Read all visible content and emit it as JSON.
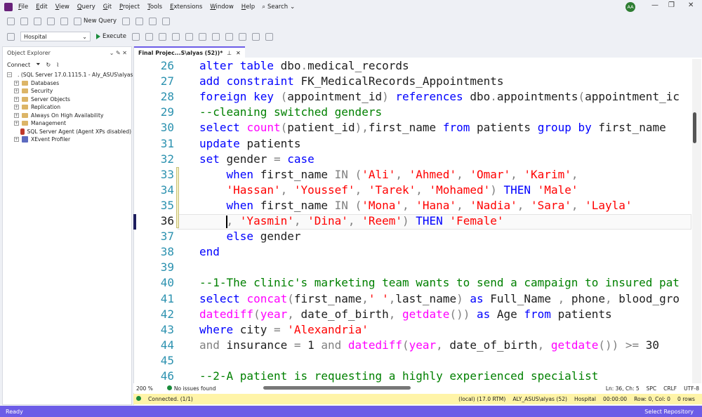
{
  "menu": [
    "File",
    "Edit",
    "View",
    "Query",
    "Git",
    "Project",
    "Tools",
    "Extensions",
    "Window",
    "Help"
  ],
  "search_label": "Search",
  "avatar_initials": "AA",
  "toolbar": {
    "new_query": "New Query",
    "database": "Hospital",
    "execute": "Execute"
  },
  "object_explorer": {
    "title": "Object Explorer",
    "connect": "Connect",
    "server": ". (SQL Server 17.0.1115.1 - Aly_ASUS\\alyas)",
    "items": [
      "Databases",
      "Security",
      "Server Objects",
      "Replication",
      "Always On High Availability",
      "Management",
      "SQL Server Agent (Agent XPs disabled)",
      "XEvent Profiler"
    ]
  },
  "tab": {
    "title": "Final Projec...S\\alyas (52))*"
  },
  "line_numbers": [
    "26",
    "27",
    "28",
    "29",
    "30",
    "31",
    "32",
    "33",
    "34",
    "35",
    "36",
    "37",
    "38",
    "39",
    "40",
    "41",
    "42",
    "43",
    "44",
    "45",
    "46"
  ],
  "code": [
    [
      [
        "kw",
        "alter table "
      ],
      [
        "",
        "dbo"
      ],
      [
        "gr",
        "."
      ],
      [
        "",
        "medical_records"
      ]
    ],
    [
      [
        "kw",
        "add constraint "
      ],
      [
        "",
        "FK_MedicalRecords_Appointments"
      ]
    ],
    [
      [
        "kw",
        "foreign key "
      ],
      [
        "gr",
        "("
      ],
      [
        "",
        "appointment_id"
      ],
      [
        "gr",
        ") "
      ],
      [
        "kw",
        "references "
      ],
      [
        "",
        "dbo"
      ],
      [
        "gr",
        "."
      ],
      [
        "",
        "appointments"
      ],
      [
        "gr",
        "("
      ],
      [
        "",
        "appointment_ic"
      ]
    ],
    [
      [
        "cmt",
        "--cleaning switched genders"
      ]
    ],
    [
      [
        "kw",
        "select "
      ],
      [
        "fn",
        "count"
      ],
      [
        "gr",
        "("
      ],
      [
        "",
        "patient_id"
      ],
      [
        "gr",
        "),"
      ],
      [
        "",
        "first_name "
      ],
      [
        "kw",
        "from "
      ],
      [
        "",
        "patients "
      ],
      [
        "kw",
        "group by "
      ],
      [
        "",
        "first_name"
      ]
    ],
    [
      [
        "kw",
        "update "
      ],
      [
        "",
        "patients"
      ]
    ],
    [
      [
        "kw",
        "set "
      ],
      [
        "",
        "gender "
      ],
      [
        "gr",
        "= "
      ],
      [
        "kw",
        "case"
      ]
    ],
    [
      [
        "",
        "    "
      ],
      [
        "kw",
        "when "
      ],
      [
        "",
        "first_name "
      ],
      [
        "gr",
        "IN ("
      ],
      [
        "str",
        "'Ali'"
      ],
      [
        "gr",
        ", "
      ],
      [
        "str",
        "'Ahmed'"
      ],
      [
        "gr",
        ", "
      ],
      [
        "str",
        "'Omar'"
      ],
      [
        "gr",
        ", "
      ],
      [
        "str",
        "'Karim'"
      ],
      [
        "gr",
        ","
      ]
    ],
    [
      [
        "",
        "    "
      ],
      [
        "str",
        "'Hassan'"
      ],
      [
        "gr",
        ", "
      ],
      [
        "str",
        "'Youssef'"
      ],
      [
        "gr",
        ", "
      ],
      [
        "str",
        "'Tarek'"
      ],
      [
        "gr",
        ", "
      ],
      [
        "str",
        "'Mohamed'"
      ],
      [
        "gr",
        ") "
      ],
      [
        "kw",
        "THEN "
      ],
      [
        "str",
        "'Male'"
      ]
    ],
    [
      [
        "",
        "    "
      ],
      [
        "kw",
        "when "
      ],
      [
        "",
        "first_name "
      ],
      [
        "gr",
        "IN ("
      ],
      [
        "str",
        "'Mona'"
      ],
      [
        "gr",
        ", "
      ],
      [
        "str",
        "'Hana'"
      ],
      [
        "gr",
        ", "
      ],
      [
        "str",
        "'Nadia'"
      ],
      [
        "gr",
        ", "
      ],
      [
        "str",
        "'Sara'"
      ],
      [
        "gr",
        ", "
      ],
      [
        "str",
        "'Layla'"
      ]
    ],
    [
      [
        "",
        "    "
      ],
      [
        "gr",
        ", "
      ],
      [
        "str",
        "'Yasmin'"
      ],
      [
        "gr",
        ", "
      ],
      [
        "str",
        "'Dina'"
      ],
      [
        "gr",
        ", "
      ],
      [
        "str",
        "'Reem'"
      ],
      [
        "gr",
        ") "
      ],
      [
        "kw",
        "THEN "
      ],
      [
        "str",
        "'Female'"
      ]
    ],
    [
      [
        "",
        "    "
      ],
      [
        "kw",
        "else "
      ],
      [
        "",
        "gender"
      ]
    ],
    [
      [
        "kw",
        "end"
      ]
    ],
    [
      [
        "",
        ""
      ]
    ],
    [
      [
        "cmt",
        "--1-The clinic's marketing team wants to send a campaign to insured pat"
      ]
    ],
    [
      [
        "kw",
        "select "
      ],
      [
        "fn",
        "concat"
      ],
      [
        "gr",
        "("
      ],
      [
        "",
        "first_name"
      ],
      [
        "gr",
        ","
      ],
      [
        "str",
        "' '"
      ],
      [
        "gr",
        ","
      ],
      [
        "",
        "last_name"
      ],
      [
        "gr",
        ") "
      ],
      [
        "kw",
        "as "
      ],
      [
        "",
        "Full_Name "
      ],
      [
        "gr",
        ", "
      ],
      [
        "",
        "phone"
      ],
      [
        "gr",
        ", "
      ],
      [
        "",
        "blood_gro"
      ]
    ],
    [
      [
        "fn",
        "datediff"
      ],
      [
        "gr",
        "("
      ],
      [
        "fn",
        "year"
      ],
      [
        "gr",
        ", "
      ],
      [
        "",
        "date_of_birth"
      ],
      [
        "gr",
        ", "
      ],
      [
        "fn",
        "getdate"
      ],
      [
        "gr",
        "()) "
      ],
      [
        "kw",
        "as "
      ],
      [
        "",
        "Age "
      ],
      [
        "kw",
        "from "
      ],
      [
        "",
        "patients"
      ]
    ],
    [
      [
        "kw",
        "where "
      ],
      [
        "",
        "city "
      ],
      [
        "gr",
        "= "
      ],
      [
        "str",
        "'Alexandria'"
      ]
    ],
    [
      [
        "gr",
        "and "
      ],
      [
        "",
        "insurance "
      ],
      [
        "gr",
        "= "
      ],
      [
        "",
        "1 "
      ],
      [
        "gr",
        "and "
      ],
      [
        "fn",
        "datediff"
      ],
      [
        "gr",
        "("
      ],
      [
        "fn",
        "year"
      ],
      [
        "gr",
        ", "
      ],
      [
        "",
        "date_of_birth"
      ],
      [
        "gr",
        ", "
      ],
      [
        "fn",
        "getdate"
      ],
      [
        "gr",
        "()) "
      ],
      [
        "gr",
        ">= "
      ],
      [
        "",
        "30"
      ]
    ],
    [
      [
        "",
        ""
      ]
    ],
    [
      [
        "cmt",
        "--2-A patient is requesting a highly experienced specialist"
      ]
    ]
  ],
  "status": {
    "zoom": "200 %",
    "issues": "No issues found",
    "position": "Ln: 36, Ch: 5",
    "spc": "SPC",
    "crlf": "CRLF",
    "encoding": "UTF-8"
  },
  "connection": {
    "state": "Connected. (1/1)",
    "server": "(local) (17.0 RTM)",
    "user": "ALY_ASUS\\alyas (52)",
    "db": "Hospital",
    "time": "00:00:00",
    "rows_info": "Row: 0, Col: 0",
    "rows": "0 rows"
  },
  "bottom": {
    "ready": "Ready",
    "repo": "Select Repository"
  },
  "colors": {
    "accent": "#6c5ce7",
    "keyword": "#0000ff",
    "string": "#ff0000",
    "comment": "#008000",
    "function": "#ff00ff"
  }
}
